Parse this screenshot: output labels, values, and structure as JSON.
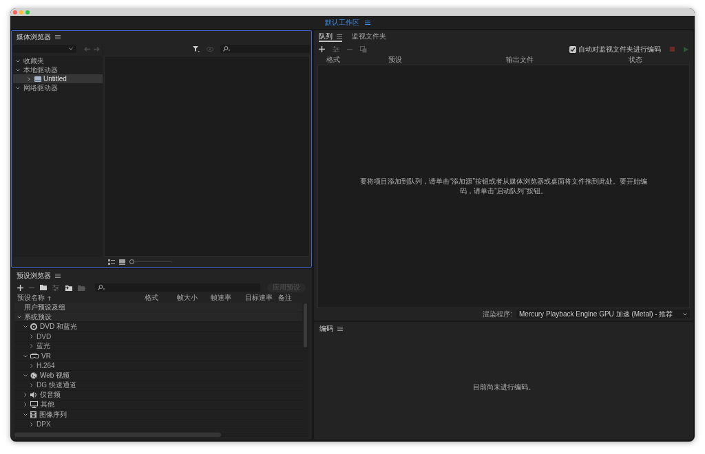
{
  "workspace_bar": {
    "title": "默认工作区"
  },
  "media_browser": {
    "title": "媒体浏览器",
    "active": true,
    "back_button": {
      "disabled": true
    },
    "forward_button": {
      "disabled": true
    },
    "preview_button": {
      "disabled": true
    },
    "tree": [
      {
        "label": "收藏夹",
        "kind": "section",
        "expanded": true,
        "selected": false
      },
      {
        "label": "本地驱动器",
        "kind": "section",
        "expanded": true,
        "selected": false,
        "children": [
          {
            "label": "Untitled",
            "kind": "drive",
            "expanded": false,
            "selected": true
          }
        ]
      },
      {
        "label": "网络驱动器",
        "kind": "section",
        "expanded": true,
        "selected": false
      }
    ],
    "zoom_slider": {
      "level": 0
    }
  },
  "preset_browser": {
    "title": "预设浏览器",
    "active": false,
    "toolbar": [
      {
        "kind": "add",
        "disabled": false
      },
      {
        "kind": "remove",
        "disabled": true
      },
      {
        "kind": "new_group",
        "disabled": false
      },
      {
        "kind": "settings",
        "disabled": true
      },
      {
        "kind": "import",
        "disabled": false
      },
      {
        "kind": "export",
        "disabled": true
      }
    ],
    "apply_button": {
      "label": "应用预设",
      "disabled": true
    },
    "columns": [
      {
        "label": "预设名称",
        "sorted": true
      },
      {
        "label": "格式",
        "sorted": false
      },
      {
        "label": "帧大小",
        "sorted": false
      },
      {
        "label": "帧速率",
        "sorted": false
      },
      {
        "label": "目标速率",
        "sorted": false
      },
      {
        "label": "备注",
        "sorted": false
      }
    ],
    "tree": [
      {
        "label": "用户预设及组",
        "kind": "group"
      },
      {
        "label": "系统预设",
        "kind": "group",
        "expanded": true,
        "children": [
          {
            "label": "DVD 和蓝光",
            "kind": "dvd",
            "expanded": true,
            "children": [
              {
                "label": "DVD",
                "kind": "folder",
                "expanded": false
              },
              {
                "label": "蓝光",
                "kind": "folder",
                "expanded": false
              }
            ]
          },
          {
            "label": "VR",
            "kind": "vr",
            "expanded": true,
            "children": [
              {
                "label": "H.264",
                "kind": "folder",
                "expanded": false
              }
            ]
          },
          {
            "label": "Web 视频",
            "kind": "web",
            "expanded": true,
            "children": [
              {
                "label": "DG 快速通道",
                "kind": "folder",
                "expanded": false
              }
            ]
          },
          {
            "label": "仅音频",
            "kind": "audio",
            "expanded": false
          },
          {
            "label": "其他",
            "kind": "other",
            "expanded": false
          },
          {
            "label": "图像序列",
            "kind": "sequence",
            "expanded": true,
            "children": [
              {
                "label": "DPX",
                "kind": "folder",
                "expanded": false
              }
            ]
          }
        ]
      }
    ]
  },
  "queue": {
    "active": false,
    "tabs": [
      {
        "label": "队列",
        "selected": true
      },
      {
        "label": "监视文件夹",
        "selected": false
      }
    ],
    "toolbar": [
      {
        "kind": "add",
        "disabled": false
      },
      {
        "kind": "settings",
        "disabled": true
      },
      {
        "kind": "remove",
        "disabled": true
      },
      {
        "kind": "duplicate",
        "disabled": true
      }
    ],
    "watch_folder_checkbox": {
      "label": "自动对监视文件夹进行编码",
      "checked": true
    },
    "stop_button": {
      "disabled": true
    },
    "start_button": {
      "disabled": true
    },
    "columns": [
      "格式",
      "预设",
      "输出文件",
      "状态"
    ],
    "empty_message": "要将项目添加到队列，请单击“添加源”按钮或者从媒体浏览器或桌面将文件拖到此处。要开始编码，请单击“启动队列”按钮。",
    "renderer": {
      "label": "渲染程序:",
      "value": "Mercury Playback Engine GPU 加速 (Metal) - 推荐"
    }
  },
  "encoding": {
    "title": "编码",
    "active": false,
    "message": "目前尚未进行编码。"
  }
}
